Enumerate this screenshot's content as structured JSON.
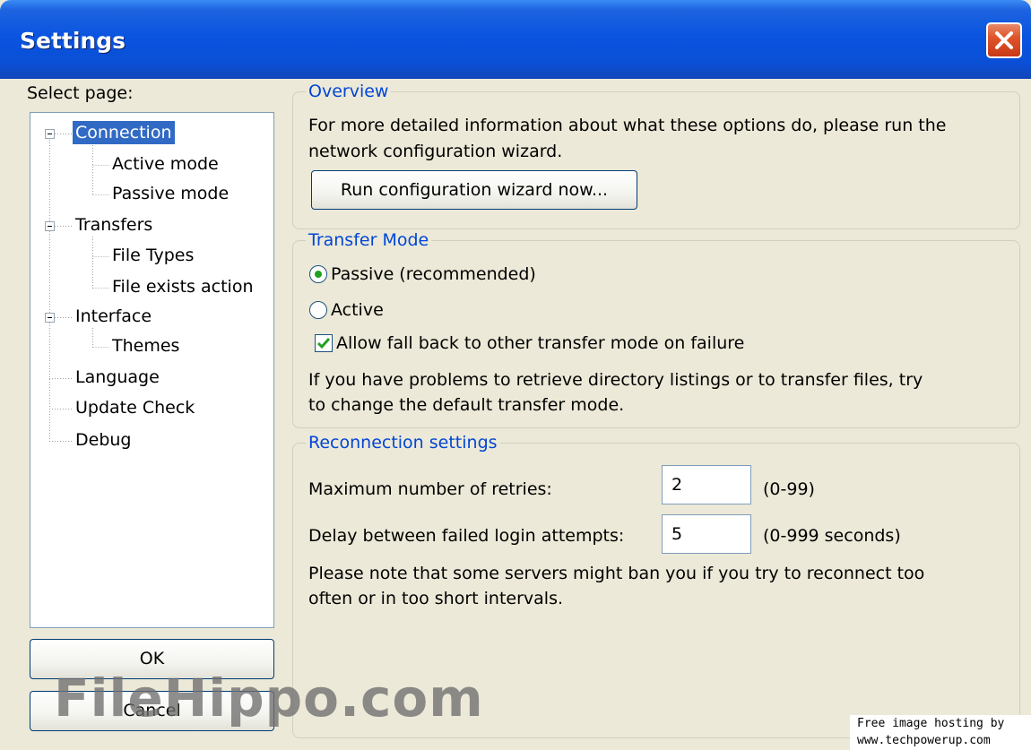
{
  "window": {
    "title": "Settings",
    "close_icon": "close-icon"
  },
  "sidebar": {
    "select_label": "Select page:",
    "tree": [
      {
        "label": "Connection",
        "selected": true
      },
      {
        "label": "Active mode"
      },
      {
        "label": "Passive mode"
      },
      {
        "label": "Transfers"
      },
      {
        "label": "File Types"
      },
      {
        "label": "File exists action"
      },
      {
        "label": "Interface"
      },
      {
        "label": "Themes"
      },
      {
        "label": "Language"
      },
      {
        "label": "Update Check"
      },
      {
        "label": "Debug"
      }
    ],
    "ok_label": "OK",
    "cancel_label": "Cancel"
  },
  "overview": {
    "legend": "Overview",
    "line1": "For more detailed information about what these options do, please run the",
    "line2": "network configuration wizard.",
    "wizard_button": "Run configuration wizard now..."
  },
  "transfer_mode": {
    "legend": "Transfer Mode",
    "passive_label": "Passive (recommended)",
    "passive_selected": true,
    "active_label": "Active",
    "active_selected": false,
    "fallback_label": "Allow fall back to other transfer mode on failure",
    "fallback_checked": true,
    "note_line1": "If you have problems to retrieve directory listings or to transfer files, try",
    "note_line2": "to change the default transfer mode."
  },
  "reconnection": {
    "legend": "Reconnection settings",
    "retries_label": "Maximum number of retries:",
    "retries_value": "2",
    "retries_range": "(0-99)",
    "delay_label": "Delay between failed login attempts:",
    "delay_value": "5",
    "delay_range": "(0-999 seconds)",
    "note_line1": "Please note that some servers might ban you if you try to reconnect too",
    "note_line2": "often or in too short intervals."
  },
  "watermarks": {
    "filehippo": "FileHippo.com",
    "tpu_line1": "Free image hosting by",
    "tpu_line2": "www.techpowerup.com"
  },
  "colors": {
    "titlebar": "#0a54e0",
    "selection": "#316ac5",
    "legend_text": "#0046d5",
    "close_button": "#e0552c"
  }
}
